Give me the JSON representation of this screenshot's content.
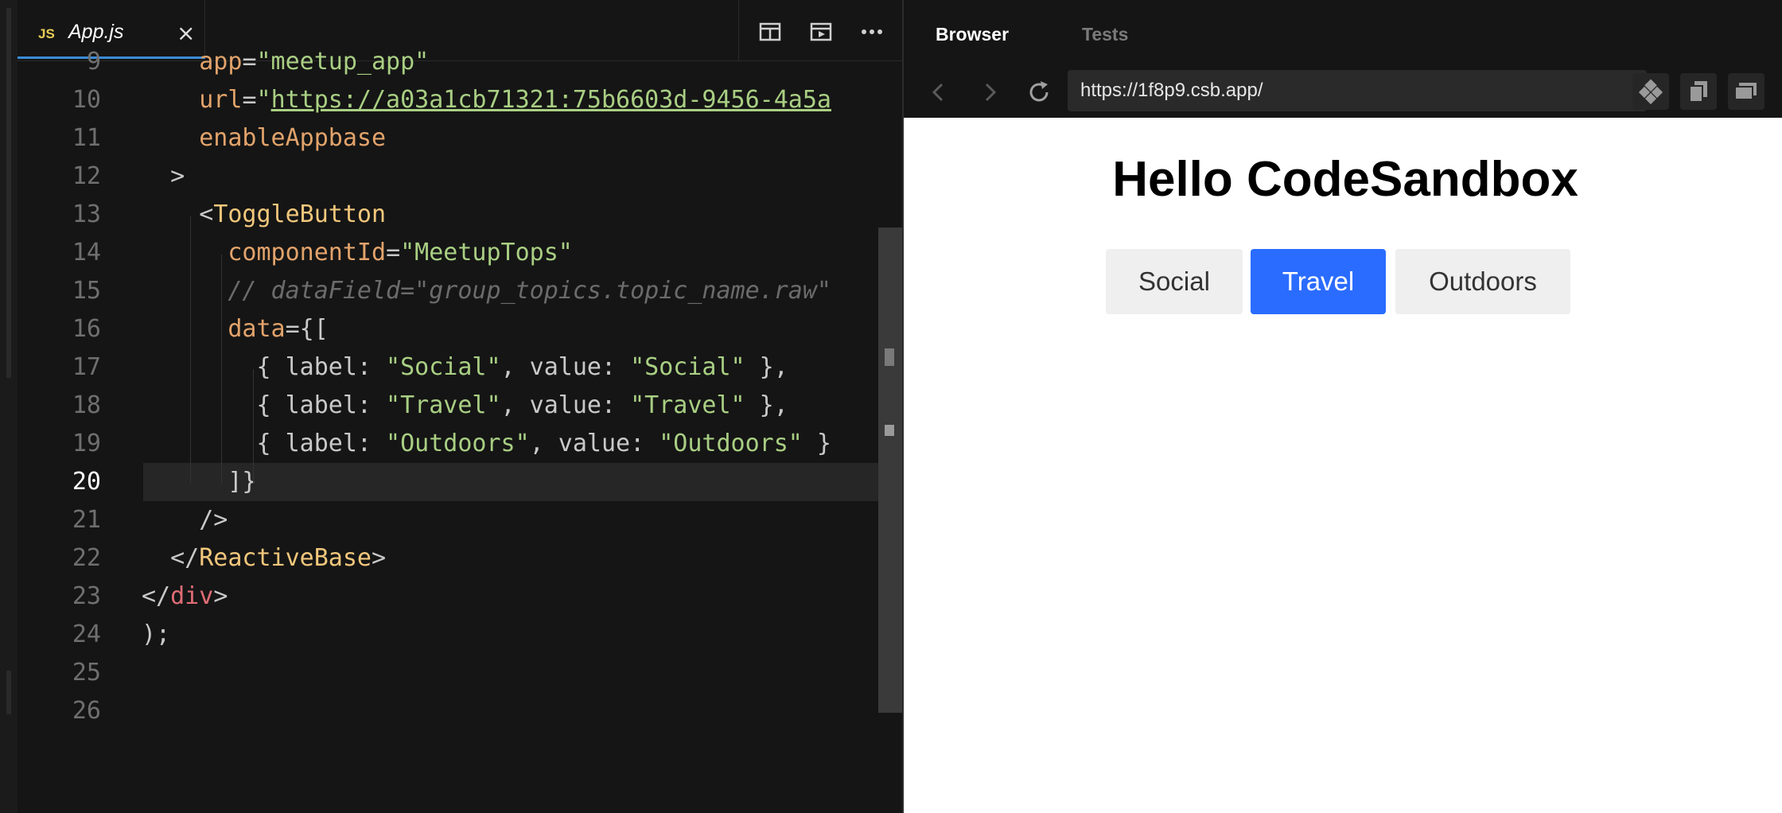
{
  "editor": {
    "tab": {
      "badge": "JS",
      "filename": "App.js",
      "close_glyph": "×"
    },
    "toolbar": [
      {
        "icon": "split-view-icon"
      },
      {
        "icon": "preview-icon"
      },
      {
        "icon": "more-icon"
      }
    ],
    "lines": [
      {
        "num": "9",
        "tokens": [
          {
            "t": "    ",
            "c": "p"
          },
          {
            "t": "app",
            "c": "a"
          },
          {
            "t": "=",
            "c": "p"
          },
          {
            "t": "\"meetup_app\"",
            "c": "s"
          }
        ]
      },
      {
        "num": "10",
        "tokens": [
          {
            "t": "    ",
            "c": "p"
          },
          {
            "t": "url",
            "c": "a"
          },
          {
            "t": "=",
            "c": "p"
          },
          {
            "t": "\"",
            "c": "s"
          },
          {
            "t": "https://a03a1cb71321:75b6603d-9456-4a5a",
            "c": "u"
          }
        ]
      },
      {
        "num": "11",
        "tokens": [
          {
            "t": "    ",
            "c": "p"
          },
          {
            "t": "enableAppbase",
            "c": "a"
          }
        ]
      },
      {
        "num": "12",
        "tokens": [
          {
            "t": "  >",
            "c": "p"
          }
        ]
      },
      {
        "num": "13",
        "tokens": [
          {
            "t": "    <",
            "c": "p"
          },
          {
            "t": "ToggleButton",
            "c": "t"
          }
        ]
      },
      {
        "num": "14",
        "tokens": [
          {
            "t": "      ",
            "c": "p"
          },
          {
            "t": "componentId",
            "c": "a"
          },
          {
            "t": "=",
            "c": "p"
          },
          {
            "t": "\"MeetupTops\"",
            "c": "s"
          }
        ]
      },
      {
        "num": "15",
        "tokens": [
          {
            "t": "      ",
            "c": "p"
          },
          {
            "t": "// dataField=\"group_topics.topic_name.raw\"",
            "c": "c"
          }
        ]
      },
      {
        "num": "16",
        "tokens": [
          {
            "t": "      ",
            "c": "p"
          },
          {
            "t": "data",
            "c": "a"
          },
          {
            "t": "={[",
            "c": "p"
          }
        ]
      },
      {
        "num": "17",
        "tokens": [
          {
            "t": "        { label: ",
            "c": "p"
          },
          {
            "t": "\"Social\"",
            "c": "s"
          },
          {
            "t": ", value: ",
            "c": "p"
          },
          {
            "t": "\"Social\"",
            "c": "s"
          },
          {
            "t": " },",
            "c": "p"
          }
        ]
      },
      {
        "num": "18",
        "tokens": [
          {
            "t": "        { label: ",
            "c": "p"
          },
          {
            "t": "\"Travel\"",
            "c": "s"
          },
          {
            "t": ", value: ",
            "c": "p"
          },
          {
            "t": "\"Travel\"",
            "c": "s"
          },
          {
            "t": " },",
            "c": "p"
          }
        ]
      },
      {
        "num": "19",
        "tokens": [
          {
            "t": "        { label: ",
            "c": "p"
          },
          {
            "t": "\"Outdoors\"",
            "c": "s"
          },
          {
            "t": ", value: ",
            "c": "p"
          },
          {
            "t": "\"Outdoors\"",
            "c": "s"
          },
          {
            "t": " }",
            "c": "p"
          }
        ]
      },
      {
        "num": "20",
        "active": true,
        "tokens": [
          {
            "t": "      ]}",
            "c": "p"
          }
        ]
      },
      {
        "num": "21",
        "tokens": [
          {
            "t": "    />",
            "c": "p"
          }
        ]
      },
      {
        "num": "22",
        "tokens": [
          {
            "t": "  </",
            "c": "p"
          },
          {
            "t": "ReactiveBase",
            "c": "t"
          },
          {
            "t": ">",
            "c": "p"
          }
        ]
      },
      {
        "num": "23",
        "tokens": [
          {
            "t": "</",
            "c": "p"
          },
          {
            "t": "div",
            "c": "r"
          },
          {
            "t": ">",
            "c": "p"
          }
        ]
      },
      {
        "num": "24",
        "tokens": [
          {
            "t": ");",
            "c": "p"
          }
        ]
      },
      {
        "num": "25",
        "tokens": []
      },
      {
        "num": "26",
        "tokens": []
      }
    ]
  },
  "preview": {
    "tabs": [
      {
        "label": "Browser",
        "active": true
      },
      {
        "label": "Tests",
        "active": false
      }
    ],
    "url": "https://1f8p9.csb.app/",
    "heading": "Hello CodeSandbox",
    "buttons": [
      {
        "label": "Social",
        "active": false
      },
      {
        "label": "Travel",
        "active": true
      },
      {
        "label": "Outdoors",
        "active": false
      }
    ]
  },
  "colors": {
    "active_button": "#2a6cff",
    "inactive_button": "#efefef",
    "tab_underline": "#3a8bd8"
  }
}
